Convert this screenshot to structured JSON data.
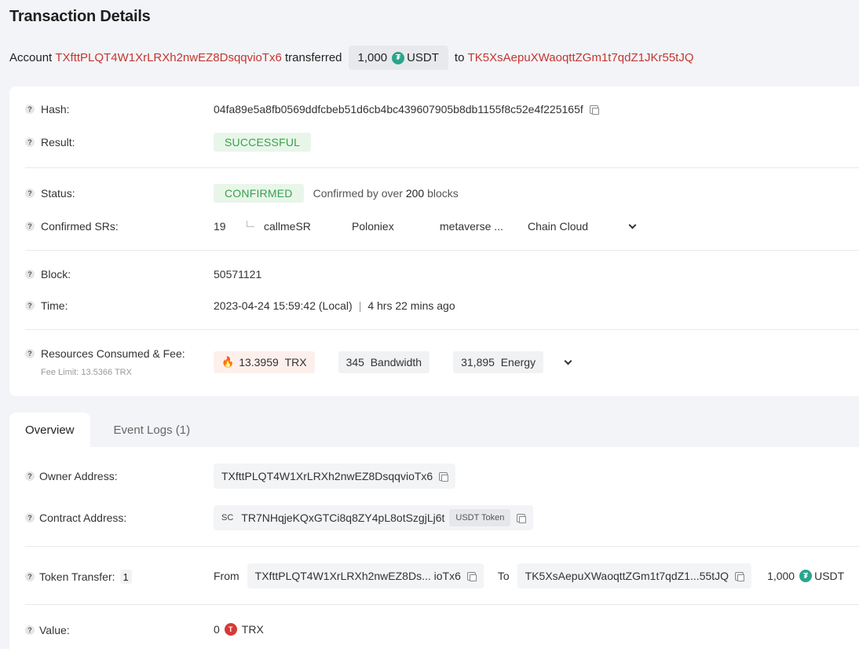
{
  "page": {
    "title": "Transaction Details"
  },
  "summary": {
    "account_word": "Account",
    "from_address": "TXfttPLQT4W1XrLRXh2nwEZ8DsqqvioTx6",
    "transferred_word": "transferred",
    "amount": "1,000",
    "token_icon": "tether-icon",
    "token": "USDT",
    "to_word": "to",
    "to_address": "TK5XsAepuXWaoqttZGm1t7qdZ1JKr55tJQ"
  },
  "details": {
    "hash": {
      "label": "Hash:",
      "value": "04fa89e5a8fb0569ddfcbeb51d6cb4bc439607905b8db1155f8c52e4f225165f"
    },
    "result": {
      "label": "Result:",
      "value": "SUCCESSFUL"
    },
    "status": {
      "label": "Status:",
      "value": "CONFIRMED",
      "note_prefix": "Confirmed by over",
      "note_count": "200",
      "note_suffix": "blocks"
    },
    "confirmed_srs": {
      "label": "Confirmed SRs:",
      "count": "19",
      "names": [
        "callmeSR",
        "Poloniex",
        "metaverse ...",
        "Chain Cloud"
      ]
    },
    "block": {
      "label": "Block:",
      "value": "50571121"
    },
    "time": {
      "label": "Time:",
      "value": "2023-04-24 15:59:42 (Local)",
      "separator": "|",
      "ago": "4 hrs 22 mins ago"
    },
    "resources": {
      "label": "Resources Consumed & Fee:",
      "fee_limit": "Fee Limit: 13.5366 TRX",
      "trx_amount": "13.3959",
      "trx_unit": "TRX",
      "bandwidth_amount": "345",
      "bandwidth_unit": "Bandwidth",
      "energy_amount": "31,895",
      "energy_unit": "Energy"
    }
  },
  "tabs": [
    {
      "label": "Overview",
      "active": true
    },
    {
      "label": "Event Logs (1)",
      "active": false
    }
  ],
  "overview": {
    "owner": {
      "label": "Owner Address:",
      "value": "TXfttPLQT4W1XrLRXh2nwEZ8DsqqvioTx6"
    },
    "contract": {
      "label": "Contract Address:",
      "prefix": "SC",
      "value": "TR7NHqjeKQxGTCi8q8ZY4pL8otSzgjLj6t",
      "tag": "USDT Token"
    },
    "token_transfer": {
      "label": "Token Transfer:",
      "count": "1",
      "from_word": "From",
      "from_value": "TXfttPLQT4W1XrLRXh2nwEZ8Ds... ioTx6",
      "to_word": "To",
      "to_value": "TK5XsAepuXWaoqttZGm1t7qdZ1...55tJQ",
      "amount": "1,000",
      "token": "USDT"
    },
    "value": {
      "label": "Value:",
      "amount": "0",
      "unit": "TRX"
    }
  },
  "colors": {
    "link_red": "#c23631",
    "success_green": "#39a04a",
    "success_bg": "#e8f6ea",
    "tether": "#2aa58c",
    "trx_red": "#d63a36"
  }
}
